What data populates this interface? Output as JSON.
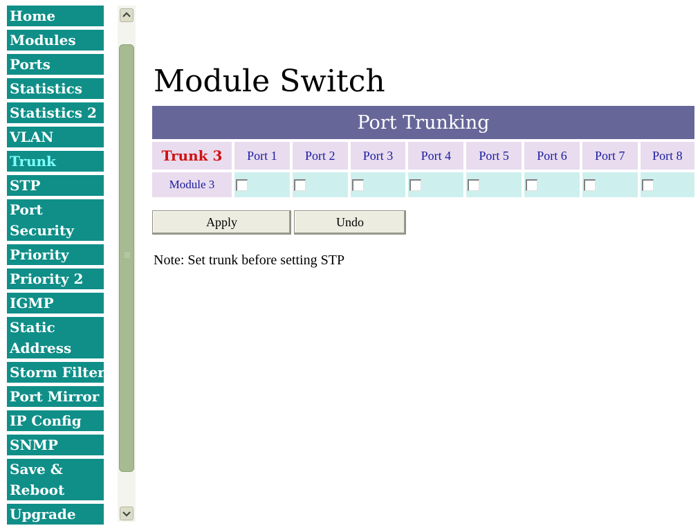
{
  "nav": {
    "items": [
      {
        "label": "Home"
      },
      {
        "label": "Modules"
      },
      {
        "label": "Ports"
      },
      {
        "label": "Statistics"
      },
      {
        "label": "Statistics 2"
      },
      {
        "label": "VLAN"
      },
      {
        "label": "Trunk",
        "active": true
      },
      {
        "label": "STP"
      },
      {
        "label": "Port Security"
      },
      {
        "label": "Priority"
      },
      {
        "label": "Priority 2"
      },
      {
        "label": "IGMP"
      },
      {
        "label": "Static Address"
      },
      {
        "label": "Storm Filter"
      },
      {
        "label": "Port Mirror"
      },
      {
        "label": "IP Config"
      },
      {
        "label": "SNMP"
      },
      {
        "label": "Save & Reboot"
      },
      {
        "label": "Upgrade"
      }
    ]
  },
  "scrollbar": {
    "up_icon": "chevron-up-icon",
    "down_icon": "chevron-down-icon"
  },
  "page": {
    "title": "Module Switch",
    "section_title": "Port Trunking",
    "trunk_label": "Trunk 3",
    "ports": [
      "Port 1",
      "Port 2",
      "Port 3",
      "Port 4",
      "Port 5",
      "Port 6",
      "Port 7",
      "Port 8"
    ],
    "module_label": "Module 3",
    "checked": [
      false,
      false,
      false,
      false,
      false,
      false,
      false,
      false
    ],
    "apply_label": "Apply",
    "undo_label": "Undo",
    "note": "Note: Set trunk before setting STP"
  },
  "colors": {
    "nav_bg": "#0f8f88",
    "nav_active_text": "#7fffff",
    "header_bg": "#666699",
    "trunk_label": "#d01010",
    "port_text": "#1a1aa0"
  }
}
